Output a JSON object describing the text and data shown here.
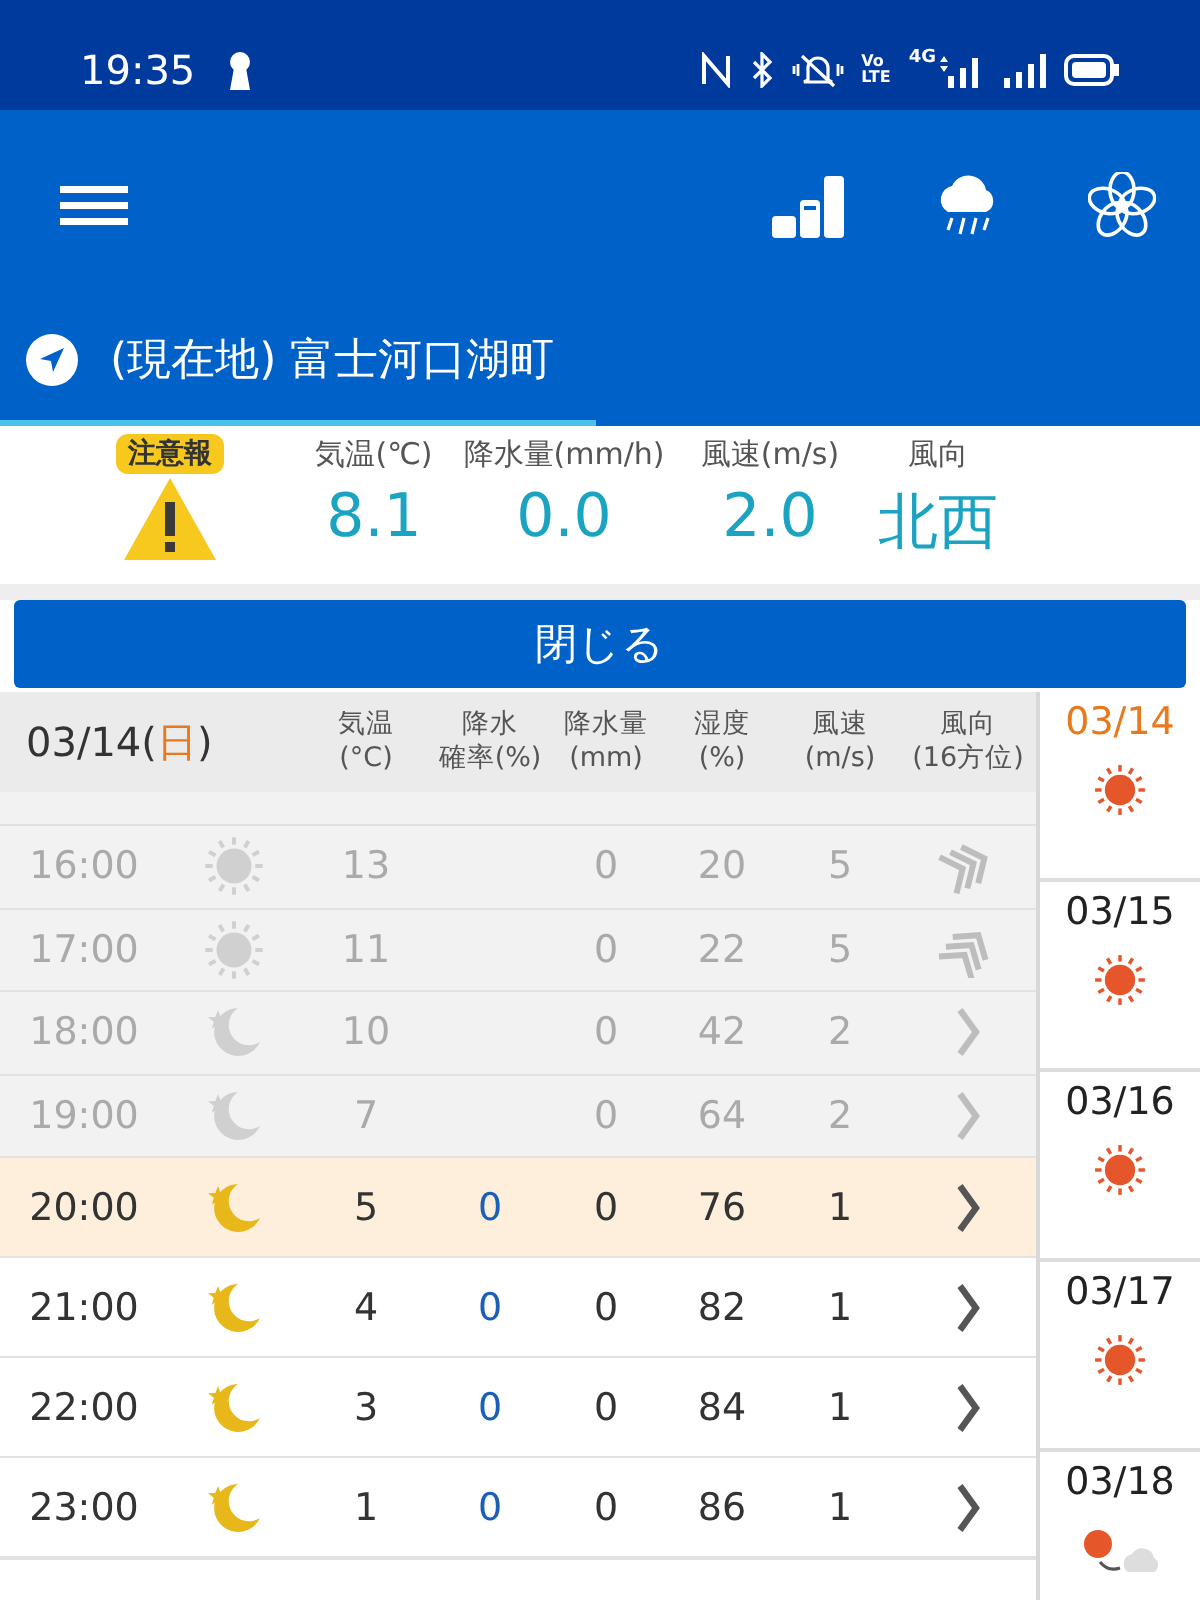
{
  "status_bar": {
    "time": "19:35",
    "volte": [
      "Vo",
      "LTE"
    ],
    "network": "4G"
  },
  "location": {
    "text": "(現在地) 富士河口湖町"
  },
  "summary": {
    "warning": {
      "label": "注意報"
    },
    "metrics": [
      {
        "label": "気温(℃)",
        "value": "8.1"
      },
      {
        "label": "降水量(mm/h)",
        "value": "0.0"
      },
      {
        "label": "風速(m/s)",
        "value": "2.0"
      },
      {
        "label": "風向",
        "value": "北西"
      }
    ]
  },
  "close_button": {
    "label": "閉じる"
  },
  "table": {
    "date": "03/14",
    "weekday_open": "(",
    "weekday": "日",
    "weekday_close": ")",
    "columns": [
      [
        "気温",
        "(°C)"
      ],
      [
        "降水",
        "確率(%)"
      ],
      [
        "降水量",
        "(mm)"
      ],
      [
        "湿度",
        "(%)"
      ],
      [
        "風速",
        "(m/s)"
      ],
      [
        "風向",
        "(16方位)"
      ]
    ],
    "rows": [
      {
        "time": "16:00",
        "past": true,
        "current": false,
        "weather_icon": {
          "kind": "sun"
        },
        "temp": "13",
        "precip": "0",
        "humidity": "20",
        "wind_speed": "5",
        "wind_icon": {
          "kind": "triplesteep"
        }
      },
      {
        "time": "17:00",
        "past": true,
        "current": false,
        "weather_icon": {
          "kind": "sun"
        },
        "temp": "11",
        "precip": "0",
        "humidity": "22",
        "wind_speed": "5",
        "wind_icon": {
          "kind": "tripleflat"
        }
      },
      {
        "time": "18:00",
        "past": true,
        "current": false,
        "weather_icon": {
          "kind": "moon"
        },
        "temp": "10",
        "precip": "0",
        "humidity": "42",
        "wind_speed": "2",
        "wind_icon": {
          "kind": "single"
        }
      },
      {
        "time": "19:00",
        "past": true,
        "current": false,
        "weather_icon": {
          "kind": "moon"
        },
        "temp": "7",
        "precip": "0",
        "humidity": "64",
        "wind_speed": "2",
        "wind_icon": {
          "kind": "single"
        }
      },
      {
        "time": "20:00",
        "past": false,
        "current": true,
        "weather_icon": {
          "kind": "moon"
        },
        "temp": "5",
        "pop": "0",
        "precip": "0",
        "humidity": "76",
        "wind_speed": "1",
        "wind_icon": {
          "kind": "single"
        }
      },
      {
        "time": "21:00",
        "past": false,
        "current": false,
        "weather_icon": {
          "kind": "moon"
        },
        "temp": "4",
        "pop": "0",
        "precip": "0",
        "humidity": "82",
        "wind_speed": "1",
        "wind_icon": {
          "kind": "single"
        }
      },
      {
        "time": "22:00",
        "past": false,
        "current": false,
        "weather_icon": {
          "kind": "moon"
        },
        "temp": "3",
        "pop": "0",
        "precip": "0",
        "humidity": "84",
        "wind_speed": "1",
        "wind_icon": {
          "kind": "single"
        }
      },
      {
        "time": "23:00",
        "past": false,
        "current": false,
        "weather_icon": {
          "kind": "moon"
        },
        "temp": "1",
        "pop": "0",
        "precip": "0",
        "humidity": "86",
        "wind_speed": "1",
        "wind_icon": {
          "kind": "single"
        }
      }
    ]
  },
  "days": [
    {
      "date": "03/14",
      "selected": true,
      "weather_icon": {
        "kind": "sun"
      }
    },
    {
      "date": "03/15",
      "selected": false,
      "weather_icon": {
        "kind": "sun"
      }
    },
    {
      "date": "03/16",
      "selected": false,
      "weather_icon": {
        "kind": "sun"
      }
    },
    {
      "date": "03/17",
      "selected": false,
      "weather_icon": {
        "kind": "sun"
      }
    },
    {
      "date": "03/18",
      "selected": false,
      "weather_icon": {
        "kind": "suncloud"
      }
    }
  ]
}
